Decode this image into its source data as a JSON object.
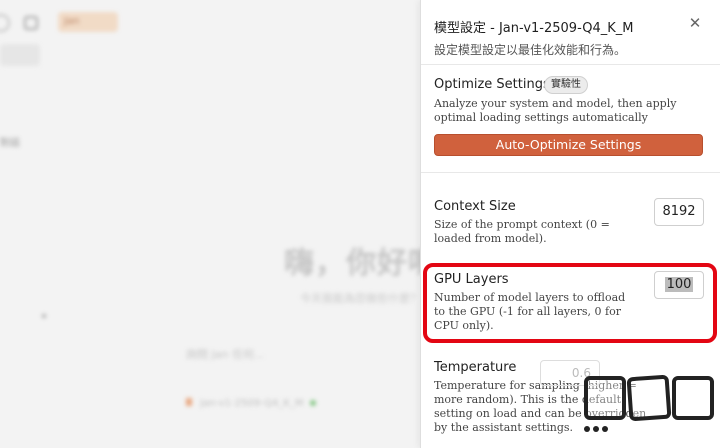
{
  "background": {
    "chip_label": "Jan",
    "greeting": "嗨，你好嗎",
    "subtitle": "今天我能為您做些什麼？",
    "input_placeholder": "詢問 Jan 任何...",
    "model_label": "Jan-v1-2509-Q4_K_M",
    "sidebar_text": "對話"
  },
  "panel": {
    "title": "模型設定 - Jan-v1-2509-Q4_K_M",
    "subtitle": "設定模型設定以最佳化效能和行為。",
    "close_icon": "close-icon",
    "optimize": {
      "title": "Optimize Settings",
      "badge": "實驗性",
      "description": "Analyze your system and model, then apply optimal loading settings automatically",
      "button_label": "Auto-Optimize Settings",
      "button_color": "#d0613d"
    },
    "context_size": {
      "title": "Context Size",
      "description": "Size of the prompt context (0 = loaded from model).",
      "value": "8192"
    },
    "gpu_layers": {
      "title": "GPU Layers",
      "description": "Number of model layers to offload to the GPU (-1 for all layers, 0 for CPU only).",
      "value": "100",
      "highlight_color": "#e30613"
    },
    "temperature": {
      "title": "Temperature",
      "description": "Temperature for sampling (higher = more random). This is the default setting on load and can be overridden by the assistant settings.",
      "value": "0.6"
    }
  }
}
